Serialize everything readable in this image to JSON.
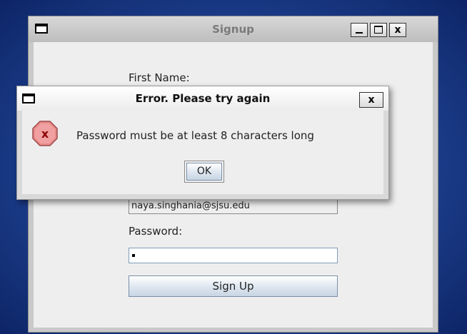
{
  "main_window": {
    "title": "Signup",
    "close_glyph": "x",
    "form": {
      "first_name_label": "First Name:",
      "email_value": "naya.singhania@sjsu.edu",
      "password_label": "Password:",
      "password_masked": "•",
      "signup_button_label": "Sign Up"
    }
  },
  "dialog": {
    "title": "Error. Please try again",
    "close_glyph": "x",
    "message": "Password must be at least 8 characters long",
    "icon": "error-icon",
    "icon_glyph": "x",
    "ok_label": "OK"
  },
  "colors": {
    "desktop": "#1d3f8e",
    "error_icon_fill": "#e88a8a",
    "error_icon_text": "#8b0000"
  }
}
